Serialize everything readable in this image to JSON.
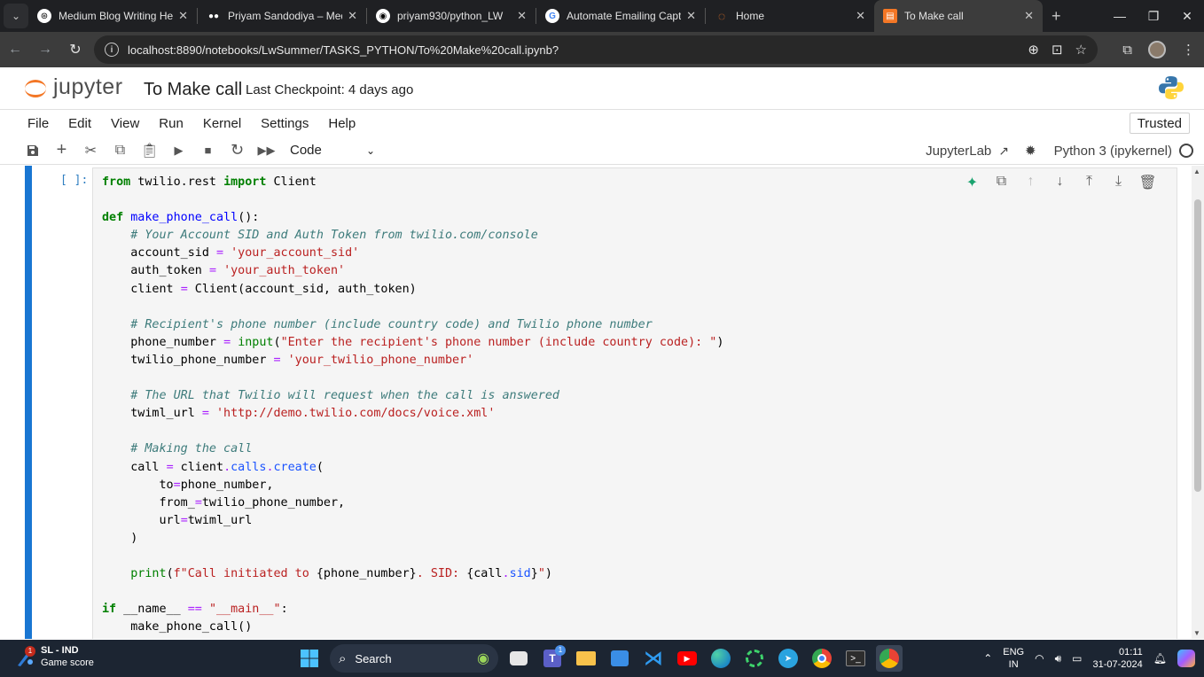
{
  "browser": {
    "tabs": [
      {
        "title": "Medium Blog Writing Help",
        "icon": "openai-icon"
      },
      {
        "title": "Priyam Sandodiya – Medium",
        "icon": "medium-icon"
      },
      {
        "title": "priyam930/python_LW",
        "icon": "github-icon"
      },
      {
        "title": "Automate Emailing Captur",
        "icon": "google-icon"
      },
      {
        "title": "Home",
        "icon": "jupyter-icon"
      },
      {
        "title": "To Make call",
        "icon": "notebook-icon",
        "active": true
      }
    ],
    "url": "localhost:8890/notebooks/LwSummer/TASKS_PYTHON/To%20Make%20call.ipynb?"
  },
  "jupyter": {
    "logo_text": "jupyter",
    "notebook_title": "To Make call",
    "checkpoint": "Last Checkpoint: 4 days ago",
    "menu": [
      "File",
      "Edit",
      "View",
      "Run",
      "Kernel",
      "Settings",
      "Help"
    ],
    "trusted": "Trusted",
    "cell_type": "Code",
    "jupyterlab_link": "JupyterLab",
    "kernel": "Python 3 (ipykernel)"
  },
  "cell": {
    "prompt": "[ ]:"
  },
  "taskbar": {
    "weather_badge": "1",
    "weather_title": "SL - IND",
    "weather_sub": "Game score",
    "search_placeholder": "Search",
    "teams_badge": "1",
    "lang_top": "ENG",
    "lang_bottom": "IN",
    "time": "01:11",
    "date": "31-07-2024"
  },
  "colors": {
    "accent": "#1976d2",
    "jupyter_orange": "#f37726",
    "chrome_dark": "#1f2023",
    "taskbar": "#1c2532"
  }
}
